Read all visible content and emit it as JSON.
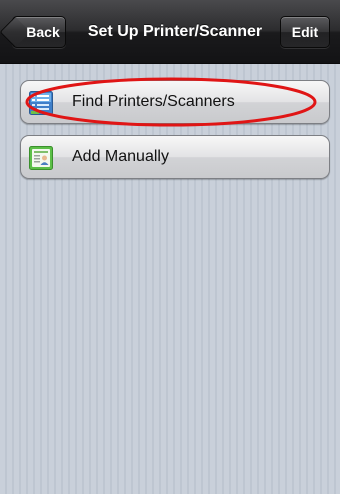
{
  "navbar": {
    "back_label": "Back",
    "title": "Set Up Printer/Scanner",
    "edit_label": "Edit"
  },
  "menu": {
    "items": [
      {
        "label": "Find Printers/Scanners",
        "icon": "find-printers-icon"
      },
      {
        "label": "Add Manually",
        "icon": "add-manually-icon"
      }
    ]
  },
  "annotation": {
    "color": "#e01515",
    "target": "Find Printers/Scanners"
  }
}
